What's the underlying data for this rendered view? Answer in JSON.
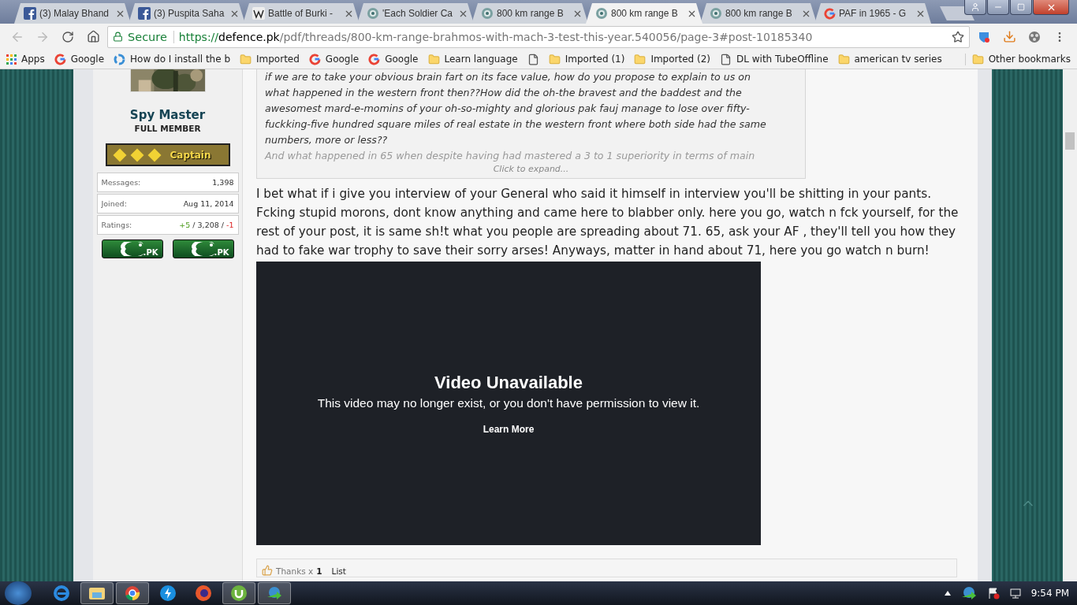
{
  "tabs": [
    {
      "title": "(3) Malay Bhand",
      "kind": "facebook",
      "selected": false
    },
    {
      "title": "(3) Puspita Saha",
      "kind": "facebook",
      "selected": false
    },
    {
      "title": "Battle of Burki -",
      "kind": "wikipedia",
      "selected": false
    },
    {
      "title": "'Each Soldier Ca",
      "kind": "forum",
      "selected": false
    },
    {
      "title": "800 km range B",
      "kind": "forum",
      "selected": false
    },
    {
      "title": "800 km range B",
      "kind": "forum",
      "selected": true
    },
    {
      "title": "800 km range B",
      "kind": "forum",
      "selected": false
    },
    {
      "title": "PAF in 1965 - G",
      "kind": "google",
      "selected": false
    }
  ],
  "address": {
    "secure_label": "Secure",
    "scheme": "https://",
    "domain": "defence.pk",
    "path": "/pdf/threads/800-km-range-brahmos-with-mach-3-test-this-year.540056/page-3#post-10185340"
  },
  "bookmarks": [
    {
      "label": "Apps",
      "kind": "apps"
    },
    {
      "label": "Google",
      "kind": "google"
    },
    {
      "label": "How do I install the b",
      "kind": "site"
    },
    {
      "label": "Imported",
      "kind": "folder"
    },
    {
      "label": "Google",
      "kind": "google"
    },
    {
      "label": "Google",
      "kind": "google"
    },
    {
      "label": "Learn language",
      "kind": "folder"
    },
    {
      "kind": "page"
    },
    {
      "label": "Imported (1)",
      "kind": "folder"
    },
    {
      "label": "Imported (2)",
      "kind": "folder"
    },
    {
      "label": "DL with TubeOffline",
      "kind": "page"
    },
    {
      "label": "american tv series",
      "kind": "folder"
    }
  ],
  "other_bookmarks": "Other bookmarks",
  "profile": {
    "name": "Spy Master",
    "member_title": "FULL MEMBER",
    "rank": "Captain",
    "stats": [
      {
        "label": "Messages:",
        "value": "1,398"
      },
      {
        "label": "Joined:",
        "value": "Aug 11, 2014"
      }
    ],
    "ratings": {
      "label": "Ratings:",
      "positive": "+5",
      "total": " / 3,208 / ",
      "negative": "-1"
    },
    "flags": [
      ".PK",
      ".PK"
    ]
  },
  "quote": {
    "lines": [
      "if we are to take your obvious brain fart on its face value, how do you propose to explain to us on",
      "what happened in the western front then??How did the oh-the bravest and the baddest and the",
      "awesomest mard-e-momins of your oh-so-mighty and glorious pak fauj manage to lose over fifty-",
      "fuckking-five hundred square miles of real estate in the western front where both side had the same",
      "numbers, more or less??"
    ],
    "faded_line": "And what happened in 65 when despite having had mastered a 3 to 1 superiority in terms of main",
    "expand": "Click to expand..."
  },
  "post_lines": [
    "I bet what if i give you interview of your General who said it himself in interview you'll be shitting in your pants.",
    "Fcking stupid morons, dont know anything and came here to blabber only. here you go, watch n fck yourself, for the",
    "rest of your post, it is same sh!t what you people are spreading about 71. 65, ask your AF , they'll tell you how they",
    "had to fake war trophy to save their sorry arses! Anyways, matter in hand about 71, here you go watch n burn!"
  ],
  "video": {
    "title": "Video Unavailable",
    "message": "This video may no longer exist, or you don't have permission to view it.",
    "link": "Learn More"
  },
  "footer": {
    "thanks": "Thanks x",
    "count": "1",
    "list": "List"
  },
  "taskbar": {
    "apps": [
      {
        "kind": "ie",
        "active": false
      },
      {
        "kind": "explorer",
        "active": true
      },
      {
        "kind": "chrome",
        "active": true
      },
      {
        "kind": "bolt",
        "active": false
      },
      {
        "kind": "firefox",
        "active": false
      },
      {
        "kind": "torrent",
        "active": true
      },
      {
        "kind": "download",
        "active": true
      }
    ],
    "clock": "9:54 PM"
  }
}
